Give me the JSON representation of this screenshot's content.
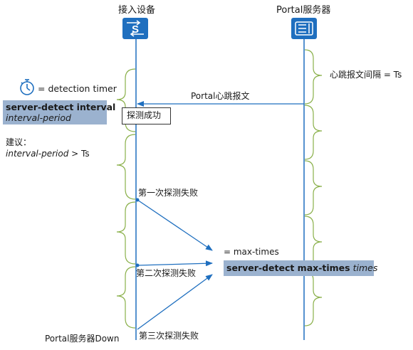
{
  "nodes": {
    "access_device": "接入设备",
    "portal_server": "Portal服务器"
  },
  "legend": {
    "timer_eq": "= detection timer",
    "interval_cmd": "server-detect interval",
    "interval_arg": "interval-period"
  },
  "advice": {
    "title": "建议：",
    "rule_arg": "interval-period",
    "rule_rest": " > Ts"
  },
  "heartbeat_interval": "心跳报文间隔 = Ts",
  "heartbeat_msg": "Portal心跳报文",
  "detect_success": "探测成功",
  "failures": {
    "first": "第一次探测失败",
    "second": "第二次探测失败",
    "third": "第三次探测失败"
  },
  "max_times": {
    "eq": "= max-times",
    "cmd": "server-detect max-times",
    "arg": "times"
  },
  "server_down": "Portal服务器Down",
  "colors": {
    "accent": "#1f6fbf",
    "highlight": "#9bb2cf",
    "brace": "#8ab04a"
  }
}
